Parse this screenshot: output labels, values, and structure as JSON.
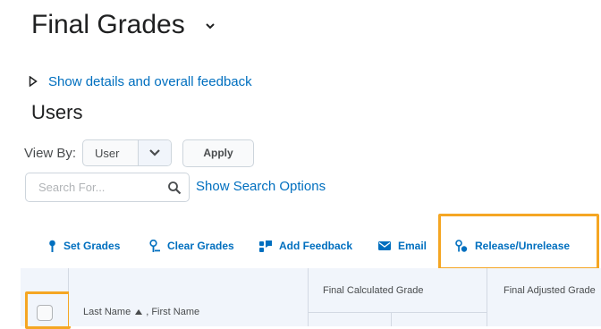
{
  "page_title": "Final Grades",
  "details_link": "Show details and overall feedback",
  "section_title": "Users",
  "view_by": {
    "label": "View By:",
    "selected": "User"
  },
  "apply_label": "Apply",
  "search": {
    "placeholder": "Search For...",
    "options_link": "Show Search Options"
  },
  "toolbar": {
    "set_grades": "Set Grades",
    "clear_grades": "Clear Grades",
    "add_feedback": "Add Feedback",
    "email": "Email",
    "release_unrelease": "Release/Unrelease"
  },
  "table": {
    "name_col_last": "Last Name",
    "name_col_first": ", First Name",
    "calculated_col": "Final Calculated Grade",
    "adjusted_col": "Final Adjusted Grade"
  },
  "colors": {
    "link": "#006fbf",
    "highlight": "#f5a623",
    "header_bg": "#f1f5fb"
  }
}
